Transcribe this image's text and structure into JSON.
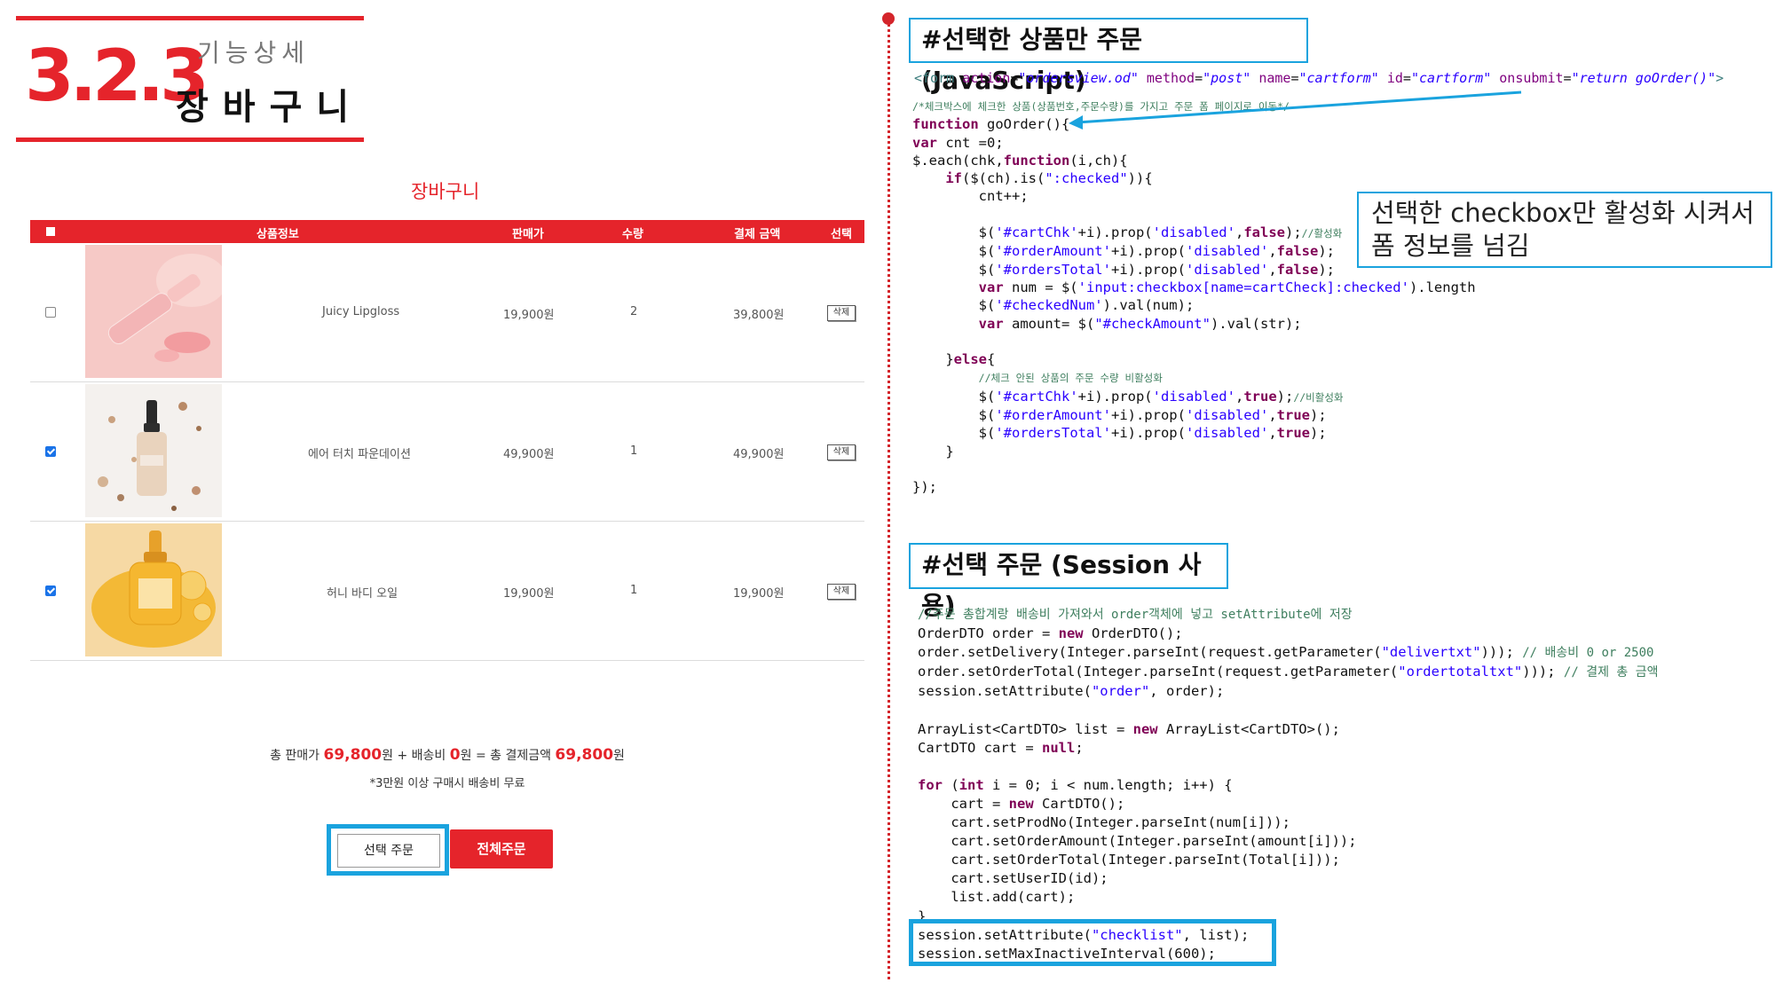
{
  "section": {
    "number": "3.2.3",
    "subtitle": "기능상세",
    "title": "장바구니"
  },
  "cart": {
    "title": "장바구니",
    "headers": [
      "상품정보",
      "판매가",
      "수량",
      "결제 금액",
      "선택"
    ],
    "rows": [
      {
        "name": "Juicy Lipgloss",
        "price": "19,900원",
        "qty": "2",
        "total": "39,800원",
        "checked": false,
        "delete_label": "삭제"
      },
      {
        "name": "에어 터치 파운데이션",
        "price": "49,900원",
        "qty": "1",
        "total": "49,900원",
        "checked": true,
        "delete_label": "삭제"
      },
      {
        "name": "허니 바디 오일",
        "price": "19,900원",
        "qty": "1",
        "total": "19,900원",
        "checked": true,
        "delete_label": "삭제"
      }
    ],
    "summary": {
      "sale_label": "총 판매가",
      "sale_amount": "69,800",
      "won": "원",
      "plus_shipping": "+ 배송비",
      "shipping_amount": "0",
      "equals_total": "= 총 결제금액",
      "total_amount": "69,800"
    },
    "note": "*3만원 이상 구매시 배송비 무료",
    "buttons": {
      "select_order": "선택 주문",
      "all_order": "전체주문"
    },
    "colors": {
      "accent": "#e5242b",
      "highlight": "#1aa3de"
    }
  },
  "js_section": {
    "title": "#선택한 상품만 주문 (JavaScript)",
    "callout": "선택한 checkbox만 활성화 시켜서 폼 정보를 넘김"
  },
  "session_section": {
    "title": "#선택 주문 (Session 사용)"
  }
}
